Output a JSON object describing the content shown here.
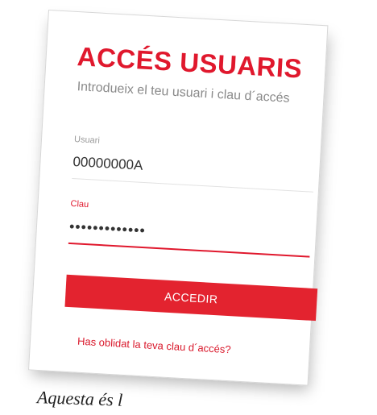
{
  "login": {
    "title": "ACCÉS USUARIS",
    "subtitle": "Introdueix el teu usuari i clau d´accés",
    "user_label": "Usuari",
    "user_value": "00000000A",
    "password_label": "Clau",
    "password_value": "•••••••••••••",
    "submit_label": "ACCEDIR",
    "forgot_link": "Has oblidat la teva clau d´accés?"
  },
  "caption": {
    "text": "Aquesta és l"
  },
  "colors": {
    "accent": "#e0182d",
    "button": "#e3232f",
    "muted_text": "#8a8a8a"
  }
}
